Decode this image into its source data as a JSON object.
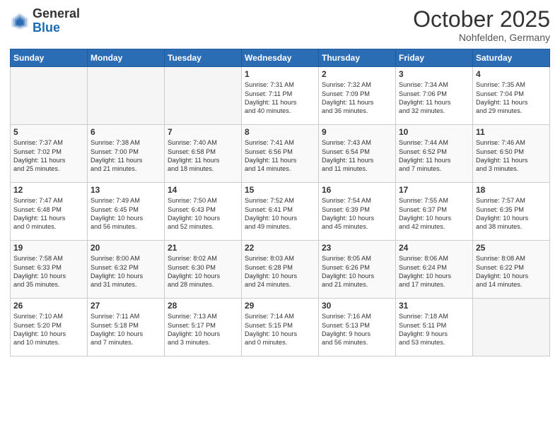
{
  "header": {
    "logo_general": "General",
    "logo_blue": "Blue",
    "month": "October 2025",
    "location": "Nohfelden, Germany"
  },
  "weekdays": [
    "Sunday",
    "Monday",
    "Tuesday",
    "Wednesday",
    "Thursday",
    "Friday",
    "Saturday"
  ],
  "rows": [
    [
      {
        "day": "",
        "info": ""
      },
      {
        "day": "",
        "info": ""
      },
      {
        "day": "",
        "info": ""
      },
      {
        "day": "1",
        "info": "Sunrise: 7:31 AM\nSunset: 7:11 PM\nDaylight: 11 hours\nand 40 minutes."
      },
      {
        "day": "2",
        "info": "Sunrise: 7:32 AM\nSunset: 7:09 PM\nDaylight: 11 hours\nand 36 minutes."
      },
      {
        "day": "3",
        "info": "Sunrise: 7:34 AM\nSunset: 7:06 PM\nDaylight: 11 hours\nand 32 minutes."
      },
      {
        "day": "4",
        "info": "Sunrise: 7:35 AM\nSunset: 7:04 PM\nDaylight: 11 hours\nand 29 minutes."
      }
    ],
    [
      {
        "day": "5",
        "info": "Sunrise: 7:37 AM\nSunset: 7:02 PM\nDaylight: 11 hours\nand 25 minutes."
      },
      {
        "day": "6",
        "info": "Sunrise: 7:38 AM\nSunset: 7:00 PM\nDaylight: 11 hours\nand 21 minutes."
      },
      {
        "day": "7",
        "info": "Sunrise: 7:40 AM\nSunset: 6:58 PM\nDaylight: 11 hours\nand 18 minutes."
      },
      {
        "day": "8",
        "info": "Sunrise: 7:41 AM\nSunset: 6:56 PM\nDaylight: 11 hours\nand 14 minutes."
      },
      {
        "day": "9",
        "info": "Sunrise: 7:43 AM\nSunset: 6:54 PM\nDaylight: 11 hours\nand 11 minutes."
      },
      {
        "day": "10",
        "info": "Sunrise: 7:44 AM\nSunset: 6:52 PM\nDaylight: 11 hours\nand 7 minutes."
      },
      {
        "day": "11",
        "info": "Sunrise: 7:46 AM\nSunset: 6:50 PM\nDaylight: 11 hours\nand 3 minutes."
      }
    ],
    [
      {
        "day": "12",
        "info": "Sunrise: 7:47 AM\nSunset: 6:48 PM\nDaylight: 11 hours\nand 0 minutes."
      },
      {
        "day": "13",
        "info": "Sunrise: 7:49 AM\nSunset: 6:45 PM\nDaylight: 10 hours\nand 56 minutes."
      },
      {
        "day": "14",
        "info": "Sunrise: 7:50 AM\nSunset: 6:43 PM\nDaylight: 10 hours\nand 52 minutes."
      },
      {
        "day": "15",
        "info": "Sunrise: 7:52 AM\nSunset: 6:41 PM\nDaylight: 10 hours\nand 49 minutes."
      },
      {
        "day": "16",
        "info": "Sunrise: 7:54 AM\nSunset: 6:39 PM\nDaylight: 10 hours\nand 45 minutes."
      },
      {
        "day": "17",
        "info": "Sunrise: 7:55 AM\nSunset: 6:37 PM\nDaylight: 10 hours\nand 42 minutes."
      },
      {
        "day": "18",
        "info": "Sunrise: 7:57 AM\nSunset: 6:35 PM\nDaylight: 10 hours\nand 38 minutes."
      }
    ],
    [
      {
        "day": "19",
        "info": "Sunrise: 7:58 AM\nSunset: 6:33 PM\nDaylight: 10 hours\nand 35 minutes."
      },
      {
        "day": "20",
        "info": "Sunrise: 8:00 AM\nSunset: 6:32 PM\nDaylight: 10 hours\nand 31 minutes."
      },
      {
        "day": "21",
        "info": "Sunrise: 8:02 AM\nSunset: 6:30 PM\nDaylight: 10 hours\nand 28 minutes."
      },
      {
        "day": "22",
        "info": "Sunrise: 8:03 AM\nSunset: 6:28 PM\nDaylight: 10 hours\nand 24 minutes."
      },
      {
        "day": "23",
        "info": "Sunrise: 8:05 AM\nSunset: 6:26 PM\nDaylight: 10 hours\nand 21 minutes."
      },
      {
        "day": "24",
        "info": "Sunrise: 8:06 AM\nSunset: 6:24 PM\nDaylight: 10 hours\nand 17 minutes."
      },
      {
        "day": "25",
        "info": "Sunrise: 8:08 AM\nSunset: 6:22 PM\nDaylight: 10 hours\nand 14 minutes."
      }
    ],
    [
      {
        "day": "26",
        "info": "Sunrise: 7:10 AM\nSunset: 5:20 PM\nDaylight: 10 hours\nand 10 minutes."
      },
      {
        "day": "27",
        "info": "Sunrise: 7:11 AM\nSunset: 5:18 PM\nDaylight: 10 hours\nand 7 minutes."
      },
      {
        "day": "28",
        "info": "Sunrise: 7:13 AM\nSunset: 5:17 PM\nDaylight: 10 hours\nand 3 minutes."
      },
      {
        "day": "29",
        "info": "Sunrise: 7:14 AM\nSunset: 5:15 PM\nDaylight: 10 hours\nand 0 minutes."
      },
      {
        "day": "30",
        "info": "Sunrise: 7:16 AM\nSunset: 5:13 PM\nDaylight: 9 hours\nand 56 minutes."
      },
      {
        "day": "31",
        "info": "Sunrise: 7:18 AM\nSunset: 5:11 PM\nDaylight: 9 hours\nand 53 minutes."
      },
      {
        "day": "",
        "info": ""
      }
    ]
  ]
}
